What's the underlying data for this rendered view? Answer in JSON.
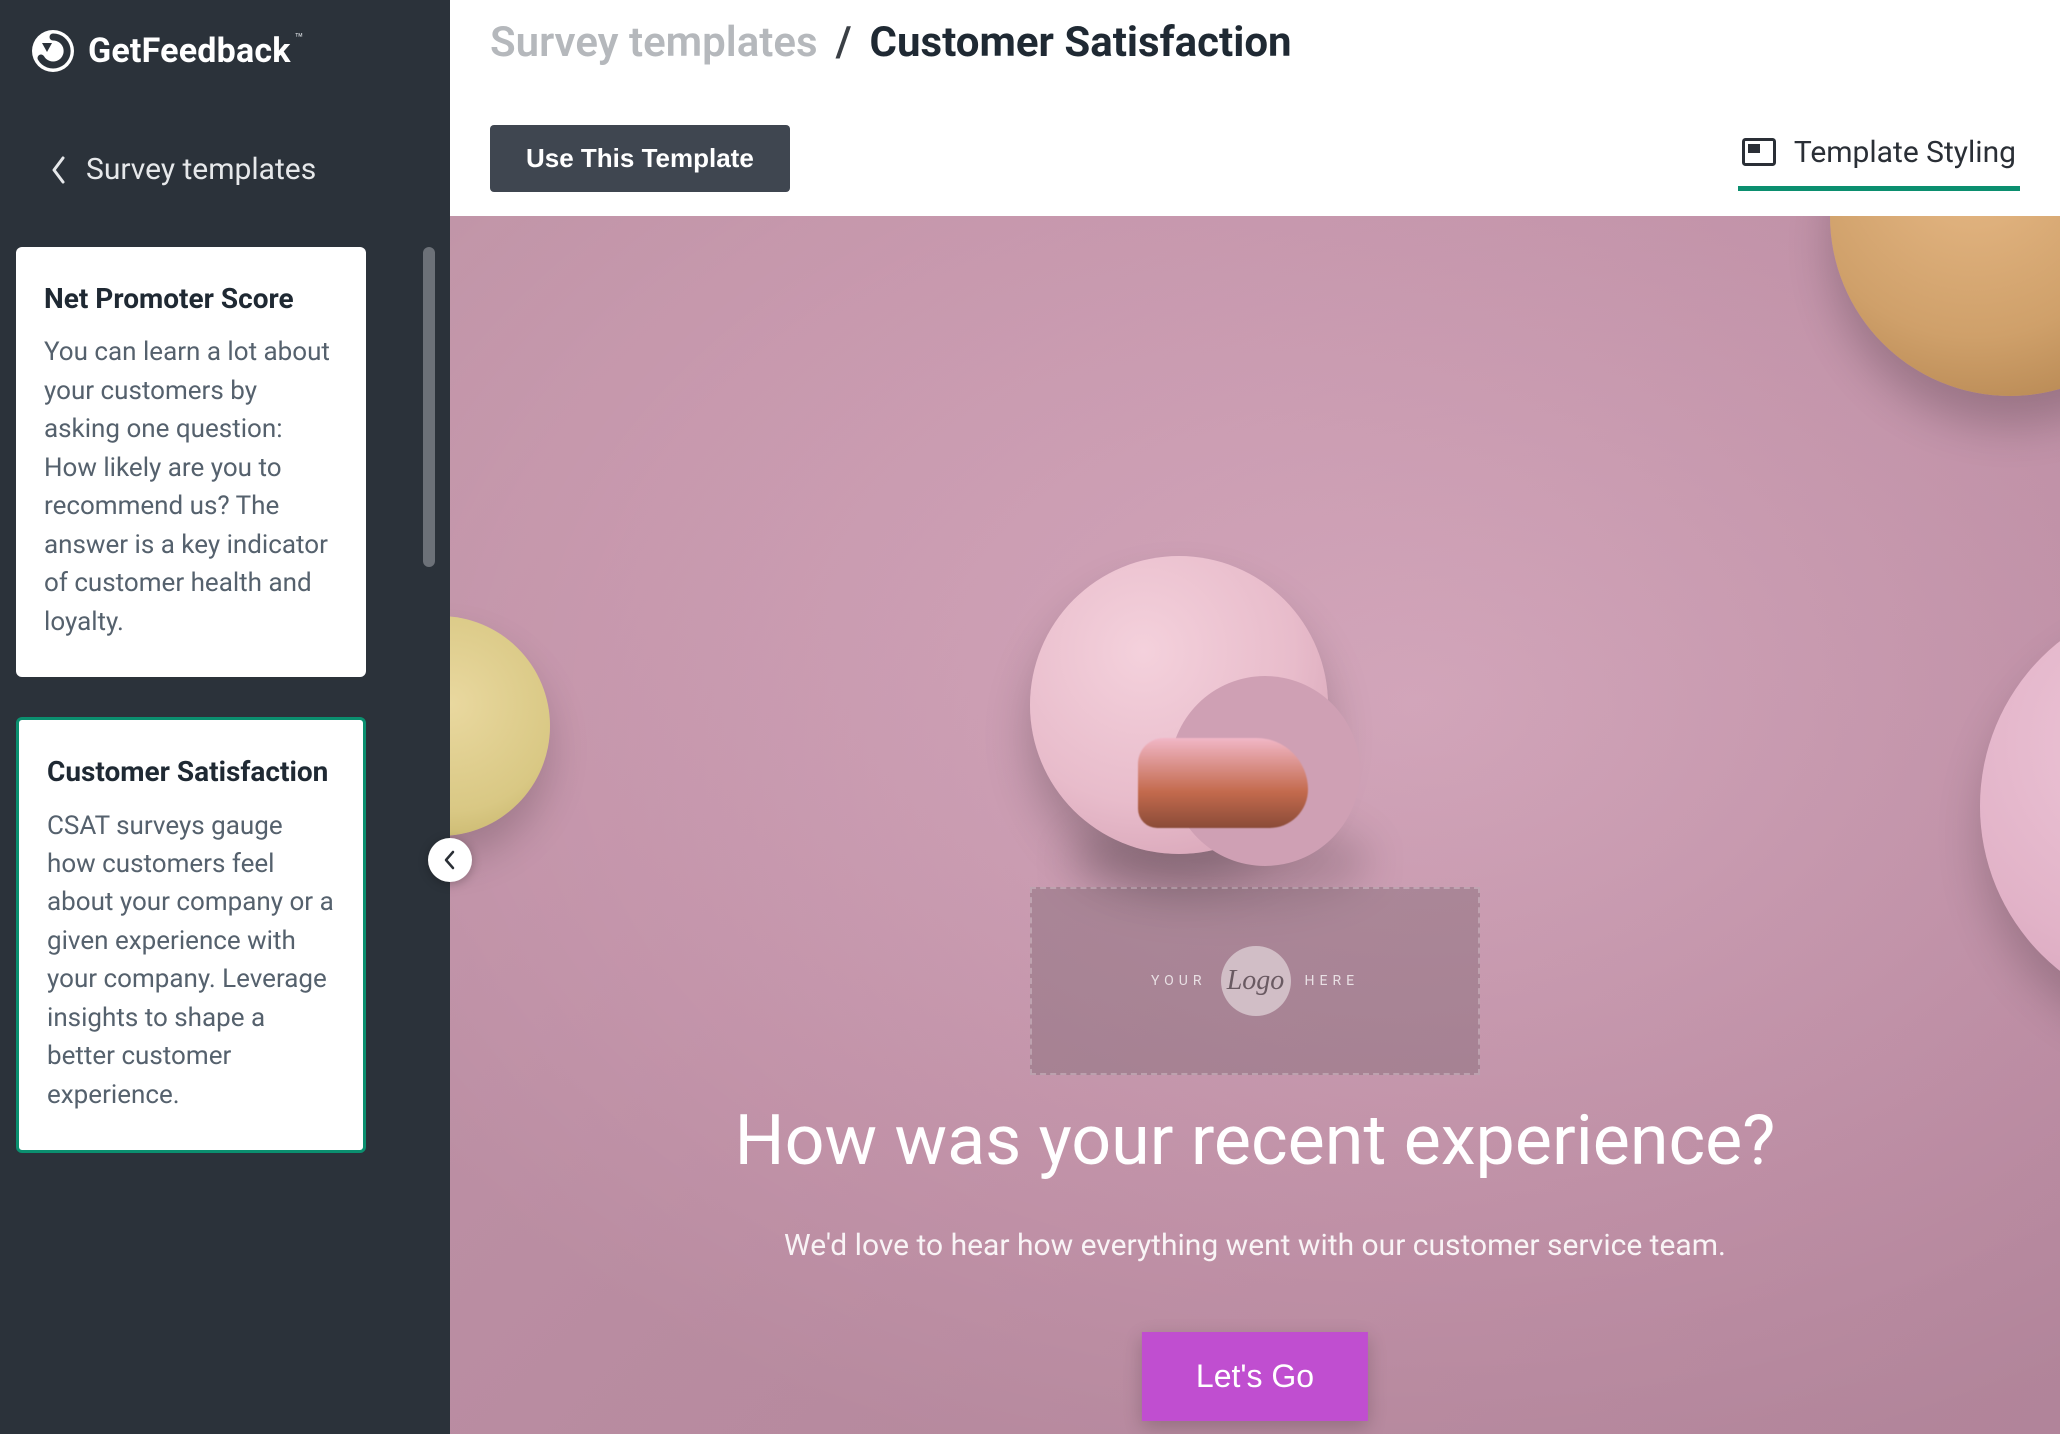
{
  "brand": {
    "name": "GetFeedback",
    "trademark": "™"
  },
  "sidebar": {
    "back_label": "Survey templates",
    "cards": [
      {
        "title": "Net Promoter Score",
        "desc": "You can learn a lot about your customers by asking one question: How likely are you to recommend us? The answer is a key indicator of customer health and loyalty.",
        "selected": false
      },
      {
        "title": "Customer Satisfaction",
        "desc": "CSAT surveys gauge how customers feel about your company or a given experience with your company. Leverage insights to shape a better customer experience.",
        "selected": true
      }
    ]
  },
  "breadcrumb": {
    "root": "Survey templates",
    "sep": "/",
    "current": "Customer Satisfaction"
  },
  "toolbar": {
    "use_template_label": "Use This Template",
    "styling_tab_label": "Template Styling"
  },
  "preview": {
    "logo_placeholder": {
      "your": "YOUR",
      "logo": "Logo",
      "here": "HERE"
    },
    "headline": "How was your recent experience?",
    "subhead": "We'd love to hear how everything went with our customer service team.",
    "cta_label": "Let's Go"
  },
  "colors": {
    "accent": "#0b8f6f",
    "cta": "#c04ed0",
    "sidebar": "#2b323a",
    "toolbar_btn": "#3f4650"
  }
}
